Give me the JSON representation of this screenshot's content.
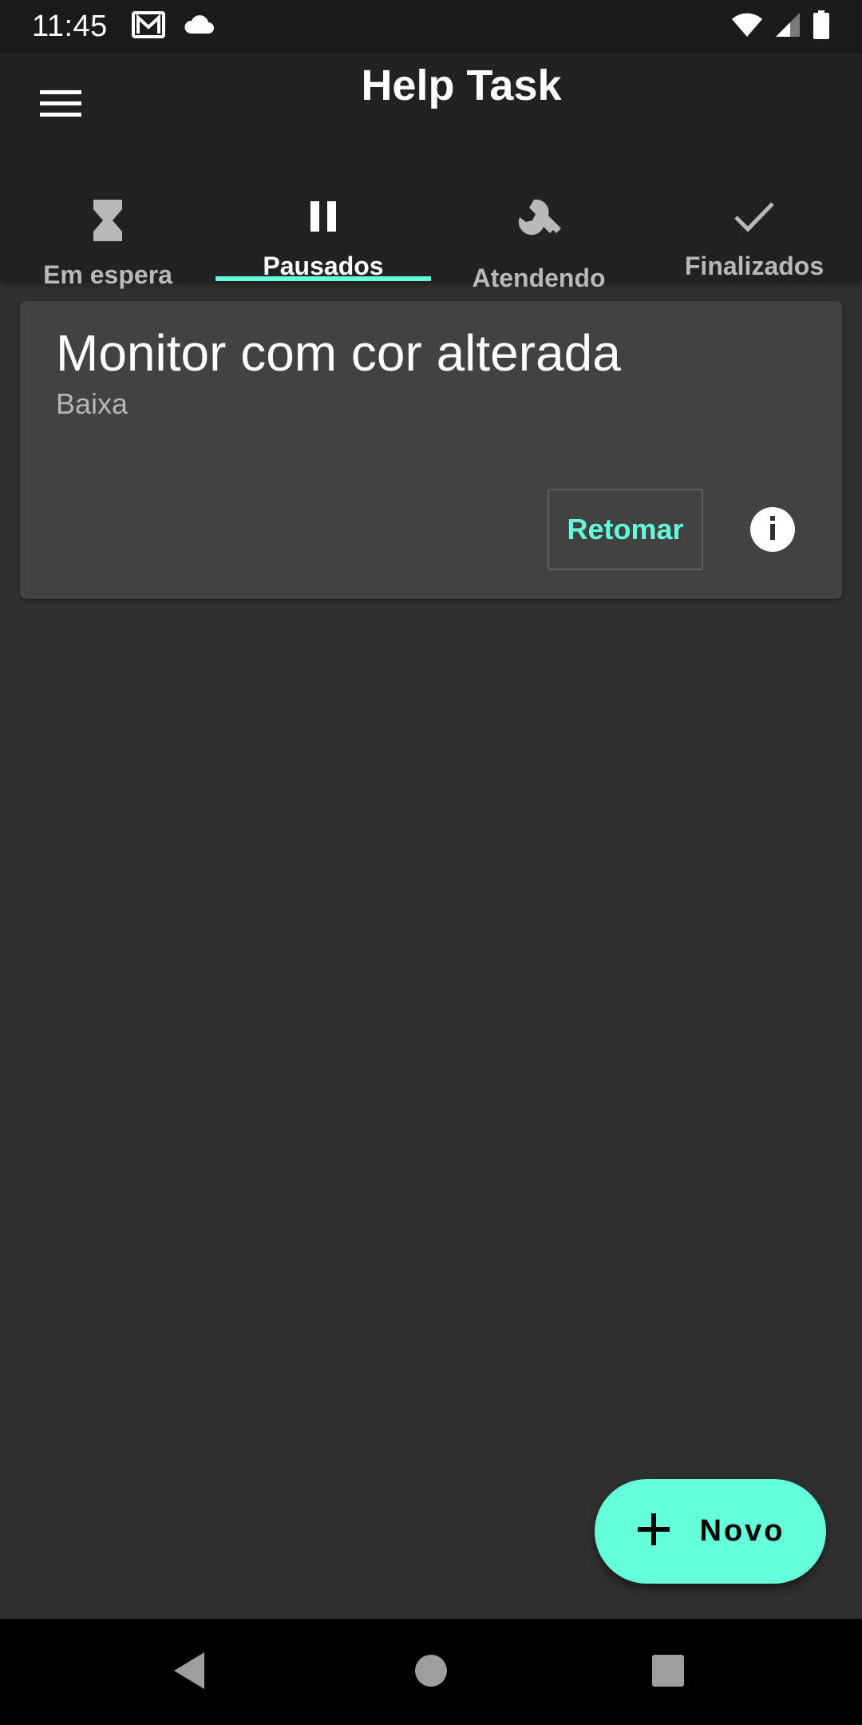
{
  "status_bar": {
    "time": "11:45",
    "icons": [
      "gmail-icon",
      "cloud-icon",
      "wifi-icon",
      "signal-icon",
      "battery-icon"
    ]
  },
  "app_bar": {
    "title": "Help Task",
    "menu_icon": "hamburger-menu-icon"
  },
  "tabs": [
    {
      "label": "Em espera",
      "icon": "hourglass-icon",
      "active": false
    },
    {
      "label": "Pausados",
      "icon": "pause-icon",
      "active": true
    },
    {
      "label": "Atendendo",
      "icon": "wrench-icon",
      "active": false
    },
    {
      "label": "Finalizados",
      "icon": "check-icon",
      "active": false
    }
  ],
  "tasks": [
    {
      "title": "Monitor com cor alterada",
      "priority": "Baixa",
      "action_label": "Retomar",
      "info_icon": "info-icon"
    }
  ],
  "fab": {
    "label": "Novo",
    "icon": "plus-icon"
  },
  "nav_bar": {
    "icons": [
      "back-icon",
      "home-icon",
      "recents-icon"
    ]
  },
  "colors": {
    "accent": "#64ffda",
    "background": "#303030",
    "app_bar": "#212121",
    "card": "#424242",
    "status_bar": "#1b1b1b"
  }
}
